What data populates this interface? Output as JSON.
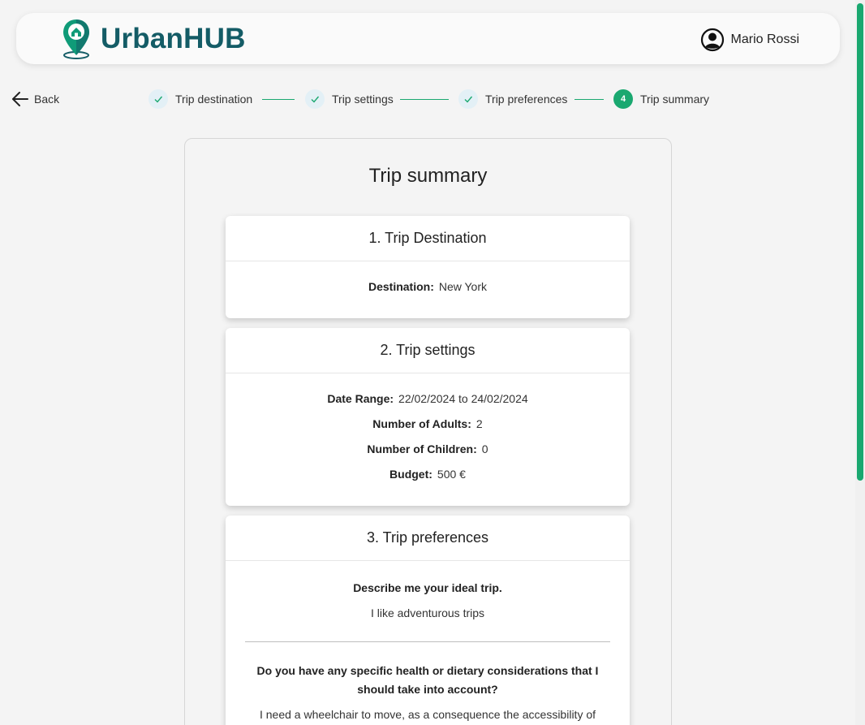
{
  "app": {
    "brand": "UrbanHUB",
    "brand_color": "#145c66",
    "accent_color": "#1aa870"
  },
  "header": {
    "user_name": "Mario Rossi",
    "user_icon": "account-circle-icon"
  },
  "nav": {
    "back_label": "Back"
  },
  "stepper": {
    "steps": [
      {
        "label": "Trip destination",
        "status": "done"
      },
      {
        "label": "Trip settings",
        "status": "done"
      },
      {
        "label": "Trip preferences",
        "status": "done"
      },
      {
        "label": "Trip summary",
        "status": "active",
        "number": "4"
      }
    ]
  },
  "summary": {
    "title": "Trip summary",
    "destination_card": {
      "title": "1. Trip Destination",
      "destination_label": "Destination:",
      "destination_value": "New York"
    },
    "settings_card": {
      "title": "2. Trip settings",
      "date_label": "Date Range:",
      "date_value": "22/02/2024 to 24/02/2024",
      "adults_label": "Number of Adults:",
      "adults_value": "2",
      "children_label": "Number of Children:",
      "children_value": "0",
      "budget_label": "Budget:",
      "budget_value": "500 €"
    },
    "preferences_card": {
      "title": "3. Trip preferences",
      "q1": "Describe me your ideal trip.",
      "a1": "I like adventurous trips",
      "q2": "Do you have any specific health or dietary considerations that I should take into account?",
      "a2": "I need a wheelchair to move, as a consequence the accessibility of"
    }
  }
}
